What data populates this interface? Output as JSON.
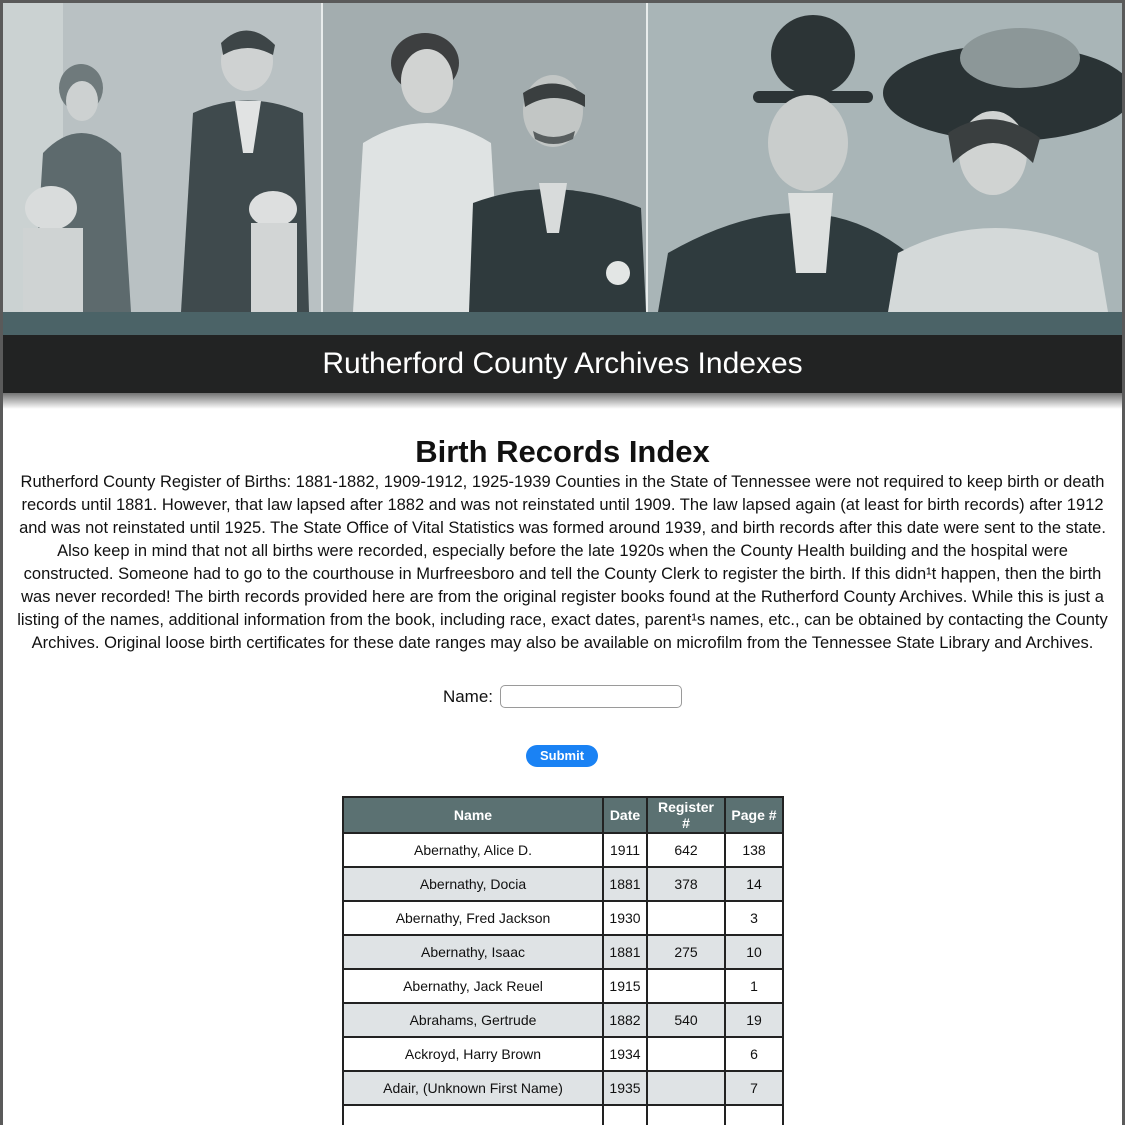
{
  "header": {
    "site_title": "Rutherford County Archives Indexes"
  },
  "page": {
    "title": "Birth Records Index",
    "intro": "Rutherford County Register of Births: 1881-1882, 1909-1912, 1925-1939 Counties in the State of Tennessee were not required to keep birth or death records until 1881. However, that law lapsed after 1882 and was not reinstated until 1909. The law lapsed again (at least for birth records) after 1912 and was not reinstated until 1925. The State Office of Vital Statistics was formed around 1939, and birth records after this date were sent to the state. Also keep in mind that not all births were recorded, especially before the late 1920s when the County Health building and the hospital were constructed. Someone had to go to the courthouse in Murfreesboro and tell the County Clerk to register the birth. If this didn¹t happen, then the birth was never recorded! The birth records provided here are from the original register books found at the Rutherford County Archives. While this is just a listing of the names, additional information from the book, including race, exact dates, parent¹s names, etc., can be obtained by contacting the County Archives. Original loose birth certificates for these date ranges may also be available on microfilm from the Tennessee State Library and Archives."
  },
  "search": {
    "label": "Name:",
    "value": "",
    "submit_label": "Submit"
  },
  "table": {
    "headers": [
      "Name",
      "Date",
      "Register #",
      "Page #"
    ],
    "rows": [
      [
        "Abernathy, Alice D.",
        "1911",
        "642",
        "138"
      ],
      [
        "Abernathy, Docia",
        "1881",
        "378",
        "14"
      ],
      [
        "Abernathy, Fred Jackson",
        "1930",
        "",
        "3"
      ],
      [
        "Abernathy, Isaac",
        "1881",
        "275",
        "10"
      ],
      [
        "Abernathy, Jack Reuel",
        "1915",
        "",
        "1"
      ],
      [
        "Abrahams, Gertrude",
        "1882",
        "540",
        "19"
      ],
      [
        "Ackroyd, Harry Brown",
        "1934",
        "",
        "6"
      ],
      [
        "Adair, (Unknown First Name)",
        "1935",
        "",
        "7"
      ],
      [
        "",
        "",
        "",
        ""
      ]
    ]
  },
  "colors": {
    "header_teal": "#4b6367",
    "title_bar": "#222323",
    "table_header": "#5b7172",
    "row_alt": "#dfe3e5",
    "submit_blue": "#1a82f4"
  }
}
